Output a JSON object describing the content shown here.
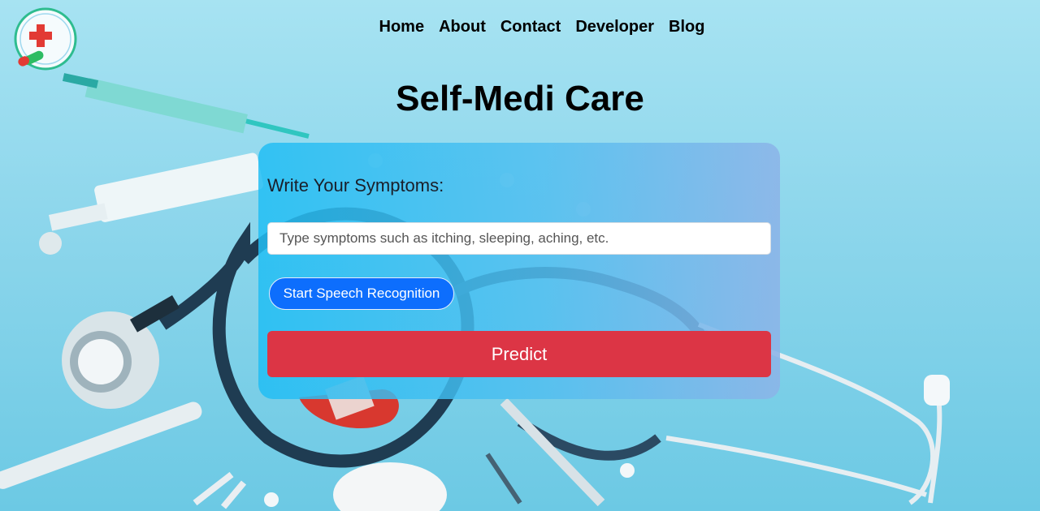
{
  "brand": {
    "logo_text": "Self-Medi Care",
    "logo_subtext": "Care",
    "logo_icon": "red-cross-pill-logo"
  },
  "nav": {
    "items": [
      {
        "label": "Home"
      },
      {
        "label": "About"
      },
      {
        "label": "Contact"
      },
      {
        "label": "Developer"
      },
      {
        "label": "Blog"
      }
    ]
  },
  "page": {
    "title": "Self-Medi Care"
  },
  "form": {
    "symptom_label": "Write Your Symptoms:",
    "symptom_value": "",
    "symptom_placeholder": "Type symptoms such as itching, sleeping, aching, etc.",
    "speech_button_label": "Start Speech Recognition",
    "predict_button_label": "Predict"
  },
  "colors": {
    "speech_button": "#0d6efd",
    "predict_button": "#dc3545",
    "background": "#8fd7ec"
  }
}
